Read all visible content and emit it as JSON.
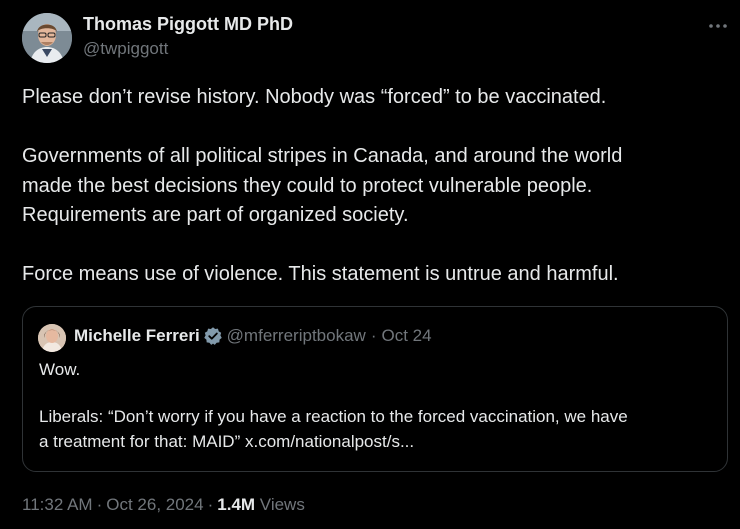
{
  "tweet": {
    "author": {
      "name": "Thomas Piggott MD PhD",
      "handle": "@twpiggott"
    },
    "body": [
      "Please don’t revise history. Nobody was “forced” to be vaccinated.",
      "",
      "Governments of all political stripes in Canada, and around the world",
      "made the best decisions they could to protect vulnerable people.",
      "Requirements are part of organized society.",
      "",
      "Force means use of violence. This statement is untrue and harmful."
    ],
    "quoted": {
      "name": "Michelle Ferreri",
      "handle": "@mferreriptbokaw",
      "separator": "·",
      "date": "Oct 24",
      "body": [
        "Wow.",
        "",
        "Liberals: “Don’t worry if you have a reaction to the forced vaccination, we have",
        "a treatment for that: MAID”"
      ],
      "link": "x.com/nationalpost/s..."
    },
    "meta": {
      "time": "11:32 AM",
      "date": "Oct 26, 2024",
      "separator": "·",
      "views_count": "1.4M",
      "views_label": "Views"
    },
    "icons": {
      "more": "more-horizontal-icon",
      "verified": "verified-badge-icon"
    },
    "colors": {
      "background": "#000000",
      "text": "#e7e9ea",
      "secondary": "#71767b",
      "border": "#2f3336",
      "verified": "#829aab"
    }
  }
}
